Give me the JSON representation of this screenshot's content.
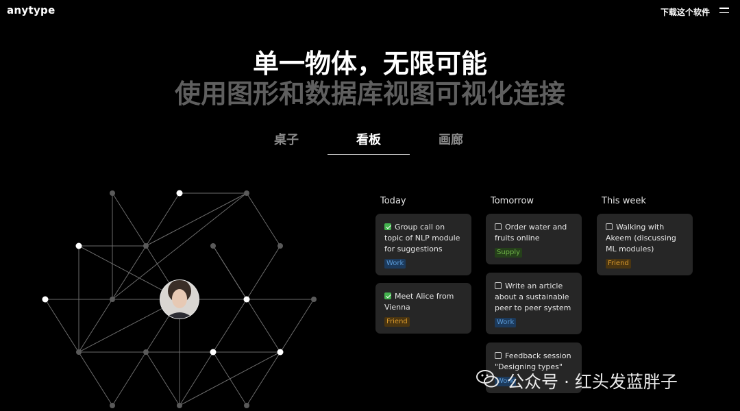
{
  "header": {
    "logo": "anytype",
    "download_label": "下载这个软件"
  },
  "hero": {
    "title": "单一物体，无限可能",
    "subtitle": "使用图形和数据库视图可视化连接"
  },
  "tabs": [
    {
      "label": "桌子",
      "active": false
    },
    {
      "label": "看板",
      "active": true
    },
    {
      "label": "画廊",
      "active": false
    }
  ],
  "kanban": {
    "columns": [
      {
        "title": "Today",
        "cards": [
          {
            "text": "Group call on topic of NLP module for suggestions",
            "checked": true,
            "tag": "Work"
          },
          {
            "text": "Meet Alice from Vienna",
            "checked": true,
            "tag": "Friend"
          }
        ]
      },
      {
        "title": "Tomorrow",
        "cards": [
          {
            "text": "Order water and fruits online",
            "checked": false,
            "tag": "Supply"
          },
          {
            "text": "Write an article about a sustainable peer to peer system",
            "checked": false,
            "tag": "Work"
          },
          {
            "text": "Feedback session \"Designing types\"",
            "checked": false,
            "tag": "Work"
          }
        ]
      },
      {
        "title": "This week",
        "cards": [
          {
            "text": "Walking with Akeem (discussing ML modules)",
            "checked": false,
            "tag": "Friend"
          }
        ]
      }
    ]
  },
  "watermark": {
    "text": "公众号 · 红头发蓝胖子"
  },
  "colors": {
    "background": "#000000",
    "card": "#262626",
    "checkbox_checked": "#44b34f",
    "tag_work": "#5b9bd8",
    "tag_friend": "#d99a2e",
    "tag_supply": "#72b54a"
  }
}
